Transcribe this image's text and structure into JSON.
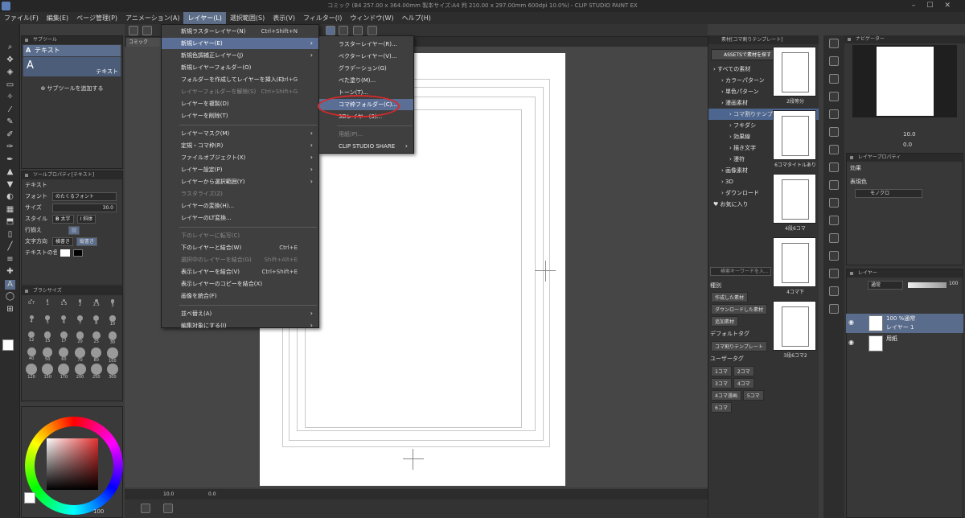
{
  "window": {
    "title": "コミック (B4 257.00 x 364.00mm 製本サイズ:A4 判 210.00 x 297.00mm 600dpi 10.0%) - CLIP STUDIO PAINT EX"
  },
  "menubar": [
    {
      "label": "ファイル(F)"
    },
    {
      "label": "編集(E)"
    },
    {
      "label": "ページ管理(P)"
    },
    {
      "label": "アニメーション(A)"
    },
    {
      "label": "レイヤー(L)",
      "active": true
    },
    {
      "label": "選択範囲(S)"
    },
    {
      "label": "表示(V)"
    },
    {
      "label": "フィルター(I)"
    },
    {
      "label": "ウィンドウ(W)"
    },
    {
      "label": "ヘルプ(H)"
    }
  ],
  "layer_menu": [
    {
      "label": "新規ラスターレイヤー(N)",
      "shortcut": "Ctrl+Shift+N"
    },
    {
      "label": "新規レイヤー(E)",
      "submenu": true,
      "highlighted": true
    },
    {
      "label": "新規色調補正レイヤー(J)",
      "submenu": true
    },
    {
      "label": "新規レイヤーフォルダー(O)"
    },
    {
      "label": "フォルダーを作成してレイヤーを挿入(F)",
      "shortcut": "Ctrl+G"
    },
    {
      "label": "レイヤーフォルダーを解除(S)",
      "shortcut": "Ctrl+Shift+G",
      "disabled": true
    },
    {
      "label": "レイヤーを複製(D)"
    },
    {
      "label": "レイヤーを削除(T)"
    },
    {
      "sep": true
    },
    {
      "label": "レイヤーマスク(M)",
      "submenu": true
    },
    {
      "label": "定規・コマ枠(R)",
      "submenu": true
    },
    {
      "label": "ファイルオブジェクト(X)",
      "submenu": true
    },
    {
      "label": "レイヤー設定(P)",
      "submenu": true
    },
    {
      "label": "レイヤーから選択範囲(Y)",
      "submenu": true
    },
    {
      "label": "ラスタライズ(Z)",
      "disabled": true
    },
    {
      "label": "レイヤーの変換(H)..."
    },
    {
      "label": "レイヤーのLT変換..."
    },
    {
      "sep": true
    },
    {
      "label": "下のレイヤーに転写(C)",
      "disabled": true
    },
    {
      "label": "下のレイヤーと結合(W)",
      "shortcut": "Ctrl+E"
    },
    {
      "label": "選択中のレイヤーを結合(G)",
      "shortcut": "Shift+Alt+E",
      "disabled": true
    },
    {
      "label": "表示レイヤーを結合(V)",
      "shortcut": "Ctrl+Shift+E"
    },
    {
      "label": "表示レイヤーのコピーを結合(X)"
    },
    {
      "label": "画像を統合(F)"
    },
    {
      "sep": true
    },
    {
      "label": "並べ替え(A)",
      "submenu": true
    },
    {
      "label": "編集対象にする(I)",
      "submenu": true
    }
  ],
  "new_layer_submenu": [
    {
      "label": "ラスターレイヤー(R)..."
    },
    {
      "label": "ベクターレイヤー(V)..."
    },
    {
      "label": "グラデーション(G)"
    },
    {
      "label": "べた塗り(M)..."
    },
    {
      "label": "トーン(T)..."
    },
    {
      "label": "コマ枠フォルダー(C)...",
      "highlighted": true
    },
    {
      "label": "3Dレイヤー(3)..."
    },
    {
      "sep": true
    },
    {
      "label": "用紙(P)...",
      "disabled": true
    },
    {
      "label": "CLIP STUDIO SHARE",
      "submenu": true
    }
  ],
  "subtool": {
    "title": "サブツール",
    "active_group": "テキスト",
    "active_tool": "テキスト",
    "add_label": "サブツールを追加する"
  },
  "toolprop": {
    "title": "ツールプロパティ[テキスト]",
    "tool_name": "テキスト",
    "font_label": "フォント",
    "font_value": "のたくるフォント",
    "size_label": "サイズ",
    "size_value": "30.0",
    "style_label": "スタイル",
    "bold_label": "太字",
    "italic_label": "斜体",
    "align_label": "行揃え",
    "direction_label": "文字方向",
    "horizontal_label": "横書き",
    "vertical_label": "縦書き",
    "textcolor_label": "テキストの色"
  },
  "brushsize": {
    "title": "ブラシサイズ",
    "sizes": [
      "0.7",
      "1",
      "1.5",
      "2",
      "2.5",
      "3",
      "4",
      "5",
      "6",
      "7",
      "8",
      "10",
      "12",
      "15",
      "17",
      "20",
      "25",
      "30",
      "40",
      "50",
      "60",
      "70",
      "80",
      "100",
      "120",
      "150",
      "170",
      "200",
      "250",
      "300"
    ]
  },
  "color": {
    "alpha_value": "100"
  },
  "canvas": {
    "tab": "コミック",
    "zoom": "10.0",
    "angle": "0.0"
  },
  "materials": {
    "title": "素材[コマ割りテンプレート]",
    "assets_button": "ASSETSで素材を探す",
    "tree": [
      {
        "label": "すべての素材",
        "depth": 0
      },
      {
        "label": "カラーパターン",
        "depth": 1
      },
      {
        "label": "単色パターン",
        "depth": 1
      },
      {
        "label": "漫画素材",
        "depth": 1
      },
      {
        "label": "コマ割りテンプレート",
        "depth": 2,
        "selected": true
      },
      {
        "label": "フキダシ",
        "depth": 2
      },
      {
        "label": "効果線",
        "depth": 2
      },
      {
        "label": "描き文字",
        "depth": 2
      },
      {
        "label": "漫符",
        "depth": 2
      },
      {
        "label": "画像素材",
        "depth": 1
      },
      {
        "label": "3D",
        "depth": 1
      },
      {
        "label": "ダウンロード",
        "depth": 1
      },
      {
        "label": "お気に入り",
        "depth": 0
      }
    ],
    "search_placeholder": "検索キーワードを入...",
    "tags_header": "種別",
    "tags_type": [
      "作成した素材",
      "ダウンロードした素材",
      "追加素材"
    ],
    "default_tags_header": "デフォルトタグ",
    "default_tags": [
      "コマ割りテンプレート"
    ],
    "user_tags_header": "ユーザータグ",
    "user_tags": [
      "1コマ",
      "2コマ",
      "3コマ",
      "4コマ",
      "4コマ漫画",
      "5コマ",
      "6コマ"
    ],
    "thumbs": [
      "2段等分",
      "6コマタイトルあり",
      "4段6コマ",
      "4コマ下",
      "3段6コマ2"
    ]
  },
  "layerprop": {
    "title": "レイヤープロパティ",
    "effect_label": "効果",
    "expr_label": "表現色",
    "expr_value": "モノクロ"
  },
  "navigator": {
    "title": "ナビゲーター",
    "zoom": "10.0",
    "angle": "0.0"
  },
  "layers": {
    "title": "レイヤー",
    "blend_mode": "通常",
    "opacity": "100",
    "items": [
      {
        "line1": "100 %通常",
        "line2": "レイヤー 1",
        "selected": true
      },
      {
        "line1": "用紙",
        "line2": ""
      }
    ]
  }
}
